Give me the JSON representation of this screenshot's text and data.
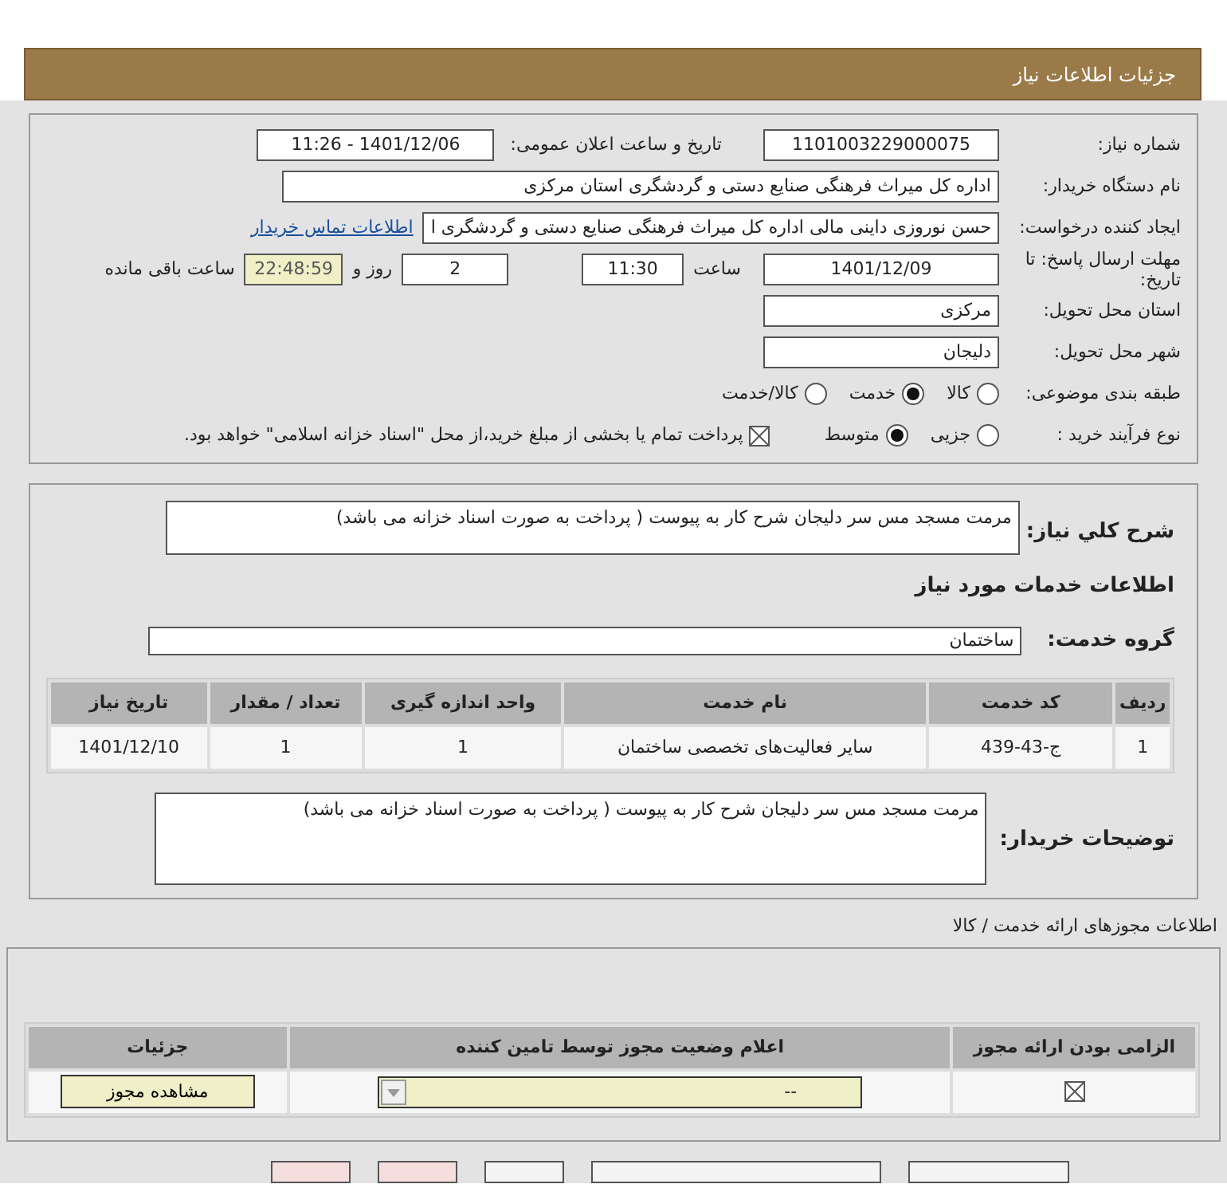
{
  "page_title": "جزئیات اطلاعات نیاز",
  "details": {
    "need_number": {
      "label": "شماره نیاز:",
      "value": "1101003229000075"
    },
    "announce": {
      "label": "تاریخ و ساعت اعلان عمومی:",
      "value": "1401/12/06 - 11:26"
    },
    "buyer": {
      "label": "نام دستگاه خریدار:",
      "value": "اداره کل میراث فرهنگی  صنایع دستی و گردشگری استان مرکزی"
    },
    "requester": {
      "label": "ایجاد کننده درخواست:",
      "value": "حسن نوروزی داینی مالی  اداره کل میراث فرهنگی  صنایع دستی و گردشگری ا",
      "link": "اطلاعات تماس خریدار"
    },
    "deadline": {
      "label": "مهلت ارسال پاسخ: تا تاریخ:",
      "date": "1401/12/09",
      "time_label": "ساعت",
      "time": "11:30",
      "days": "2",
      "days_label": "روز و",
      "remaining": "22:48:59",
      "remaining_label": "ساعت باقی مانده"
    },
    "province": {
      "label": "استان محل تحویل:",
      "value": "مرکزی"
    },
    "city": {
      "label": "شهر محل تحویل:",
      "value": "دلیجان"
    },
    "category": {
      "label": "طبقه بندی موضوعی:",
      "options": [
        {
          "label": "کالا",
          "selected": false
        },
        {
          "label": "خدمت",
          "selected": true
        },
        {
          "label": "کالا/خدمت",
          "selected": false
        }
      ]
    },
    "process": {
      "label": "نوع فرآیند خرید :",
      "options": [
        {
          "label": "جزیی",
          "selected": false
        },
        {
          "label": "متوسط",
          "selected": true
        }
      ],
      "payment": {
        "checked": true,
        "label": "پرداخت تمام یا بخشی از مبلغ خرید،از محل \"اسناد خزانه اسلامی\" خواهد بود."
      }
    }
  },
  "services": {
    "summary_label": "شرح کلي نیاز:",
    "summary": "مرمت مسجد مس سر دلیجان شرح کار به پیوست  ( پرداخت به صورت اسناد خزانه می باشد)",
    "heading": "اطلاعات خدمات مورد نیاز",
    "group_label": "گروه خدمت:",
    "group": "ساختمان",
    "table": {
      "columns": [
        "ردیف",
        "کد خدمت",
        "نام خدمت",
        "واحد اندازه گیری",
        "تعداد / مقدار",
        "تاریخ نیاز"
      ],
      "rows": [
        [
          "1",
          "ج-43-439",
          "سایر فعالیت‌های تخصصی ساختمان",
          "1",
          "1",
          "1401/12/10"
        ]
      ]
    },
    "notes_label": "توضیحات خریدار:",
    "notes": "مرمت مسجد مس سر دلیجان شرح کار به پیوست  ( پرداخت به صورت اسناد خزانه می باشد)"
  },
  "licenses": {
    "title": "اطلاعات مجوزهای ارائه خدمت / کالا",
    "columns": [
      "الزامی بودن ارائه مجوز",
      "اعلام وضعیت مجوز توسط تامین کننده",
      "جزئیات"
    ],
    "rows": [
      {
        "required": true,
        "status": "--",
        "button": "مشاهده مجوز"
      }
    ]
  },
  "bottom_buttons": [
    {
      "kind": "plain"
    },
    {
      "kind": "plain"
    },
    {
      "kind": "plain"
    },
    {
      "kind": "danger"
    },
    {
      "kind": "danger"
    }
  ]
}
